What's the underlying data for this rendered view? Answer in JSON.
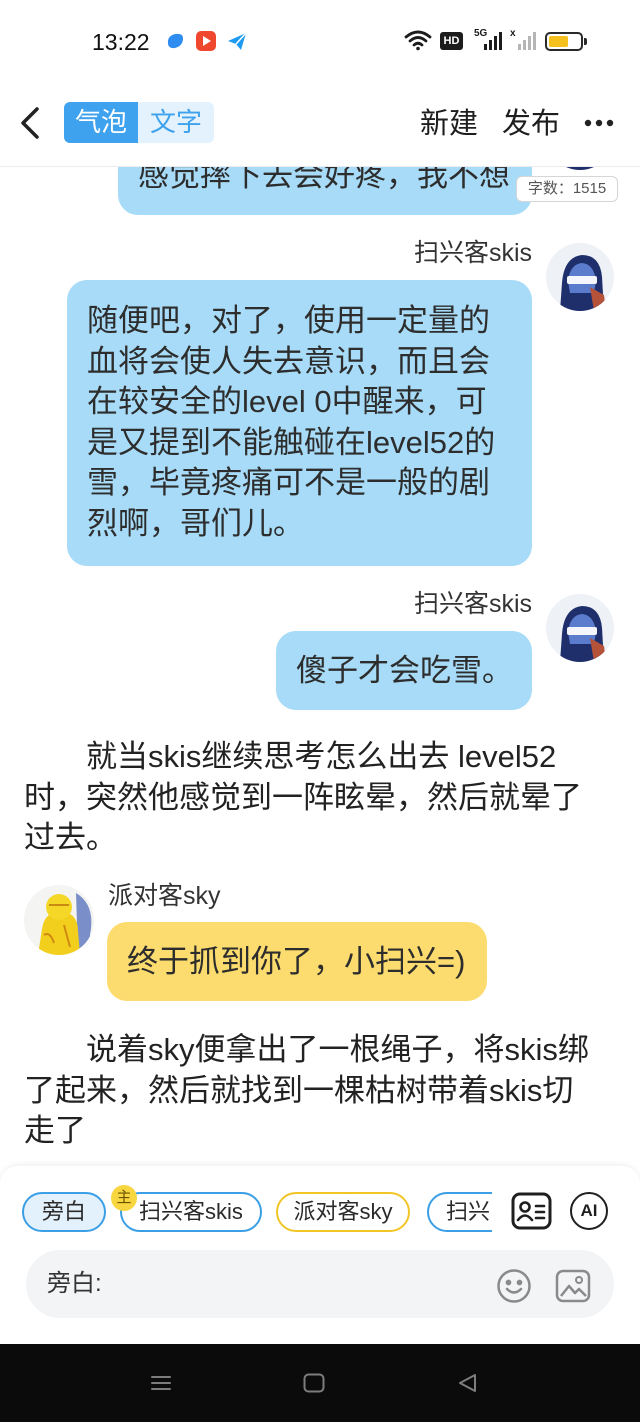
{
  "status_bar": {
    "time": "13:22",
    "app_icons": [
      "app-notification-icon",
      "video-app-icon",
      "paper-plane-icon"
    ],
    "hd_label": "HD",
    "network_label": "5G",
    "no_signal_mark": "x",
    "battery_level": 0.62
  },
  "header": {
    "back_icon": "chevron-left-icon",
    "mode_tabs": [
      {
        "label": "气泡",
        "selected": true
      },
      {
        "label": "文字",
        "selected": false
      }
    ],
    "new_label": "新建",
    "publish_label": "发布",
    "more_icon": "more-horizontal-icon"
  },
  "editor": {
    "word_count": "字数：1515",
    "story": [
      {
        "avatar_icon": "skis-avatar",
        "lines": [
          "感觉摔下去会好疼，我不想"
        ]
      },
      {
        "speaker": "扫兴客skis",
        "avatar_icon": "skis-avatar",
        "lines": [
          "随便吧，对了，使用一定量的",
          "血将会使人失去意识，而且会",
          "在较安全的level 0中醒来，可",
          "是又提到不能触碰在level52的",
          "雪，毕竟疼痛可不是一般的剧",
          "烈啊，哥们儿。"
        ]
      },
      {
        "speaker": "扫兴客skis",
        "avatar_icon": "skis-avatar",
        "lines": [
          "傻子才会吃雪。"
        ]
      },
      {
        "narration": true,
        "lines": [
          "就当skis继续思考怎么出去 level52",
          "时，突然他感觉到一阵眩晕，然后就晕了",
          "过去。"
        ]
      },
      {
        "speaker": "派对客sky",
        "avatar_icon": "sky-avatar",
        "lines": [
          "终于抓到你了，小扫兴=)"
        ]
      },
      {
        "narration": true,
        "lines": [
          "说着sky便拿出了一根绳子，将skis绑",
          "了起来，然后就找到一棵枯树带着skis切",
          "走了"
        ]
      }
    ]
  },
  "role_bar": {
    "roles": [
      {
        "label": "旁白",
        "selected": true
      },
      {
        "label": "扫兴客skis",
        "badge": "主",
        "selected": false
      },
      {
        "label": "派对客sky",
        "selected": false
      },
      {
        "label": "扫兴",
        "selected": false
      }
    ],
    "role_card_icon": "contact-card-icon",
    "ai_label": "AI"
  },
  "composer": {
    "label": "旁白:",
    "emoji_icon": "emoji-icon",
    "image_icon": "image-icon"
  },
  "nav_bar": {
    "icons": [
      "menu-icon",
      "home-square-icon",
      "back-triangle-icon"
    ]
  },
  "colors": {
    "accent": "#3ea2ee",
    "tab_light": "#e3f2fc",
    "bubble_blue": "#a7dbf7",
    "bubble_yellow": "#fcdc6e",
    "role_blue": "#3b9fe6",
    "role_yellow": "#f2c526",
    "role_selected_fill": "#e3f1fc",
    "badge_yellow": "#f8d640",
    "battery": "#f5c11f"
  }
}
